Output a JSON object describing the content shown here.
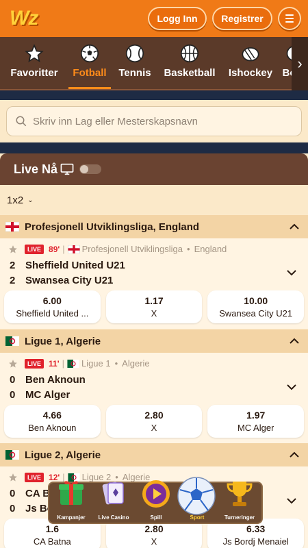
{
  "header": {
    "logo": "Wz",
    "login_label": "Logg Inn",
    "register_label": "Registrer"
  },
  "sports": [
    "Favoritter",
    "Fotball",
    "Tennis",
    "Basketball",
    "Ishockey",
    "Bord"
  ],
  "search": {
    "placeholder": "Skriv inn Lag eller Mesterskapsnavn"
  },
  "live": {
    "title": "Live Nå"
  },
  "market": {
    "selected": "1x2"
  },
  "leagues": [
    {
      "title": "Profesjonell Utviklingsliga, England",
      "match": {
        "live": "LIVE",
        "minute": "89'",
        "competition": "Profesjonell Utviklingsliga",
        "country": "England",
        "home_score": "2",
        "home": "Sheffield United U21",
        "away_score": "2",
        "away": "Swansea City U21",
        "odds": [
          {
            "value": "6.00",
            "label": "Sheffield United ..."
          },
          {
            "value": "1.17",
            "label": "X"
          },
          {
            "value": "10.00",
            "label": "Swansea City U21"
          }
        ]
      }
    },
    {
      "title": "Ligue 1, Algerie",
      "match": {
        "live": "LIVE",
        "minute": "11'",
        "competition": "Ligue 1",
        "country": "Algerie",
        "home_score": "0",
        "home": "Ben Aknoun",
        "away_score": "0",
        "away": "MC Alger",
        "odds": [
          {
            "value": "4.66",
            "label": "Ben Aknoun"
          },
          {
            "value": "2.80",
            "label": "X"
          },
          {
            "value": "1.97",
            "label": "MC Alger"
          }
        ]
      }
    },
    {
      "title": "Ligue 2, Algerie",
      "match": {
        "live": "LIVE",
        "minute": "12'",
        "competition": "Ligue 2",
        "country": "Algerie",
        "home_score": "0",
        "home": "CA Batna",
        "away_score": "0",
        "away": "Js Bordj Menaiel",
        "odds": [
          {
            "value": "1.6",
            "label": "CA Batna"
          },
          {
            "value": "2.80",
            "label": "X"
          },
          {
            "value": "6.33",
            "label": "Js Bordj Menaiel"
          }
        ]
      }
    }
  ],
  "dock": [
    "Kampanjer",
    "Live Casino",
    "Spill",
    "Sport",
    "Turneringer"
  ],
  "colors": {
    "brand_orange": "#f07a17",
    "live_red": "#e0222c",
    "active_tab": "#ff8c1a"
  }
}
